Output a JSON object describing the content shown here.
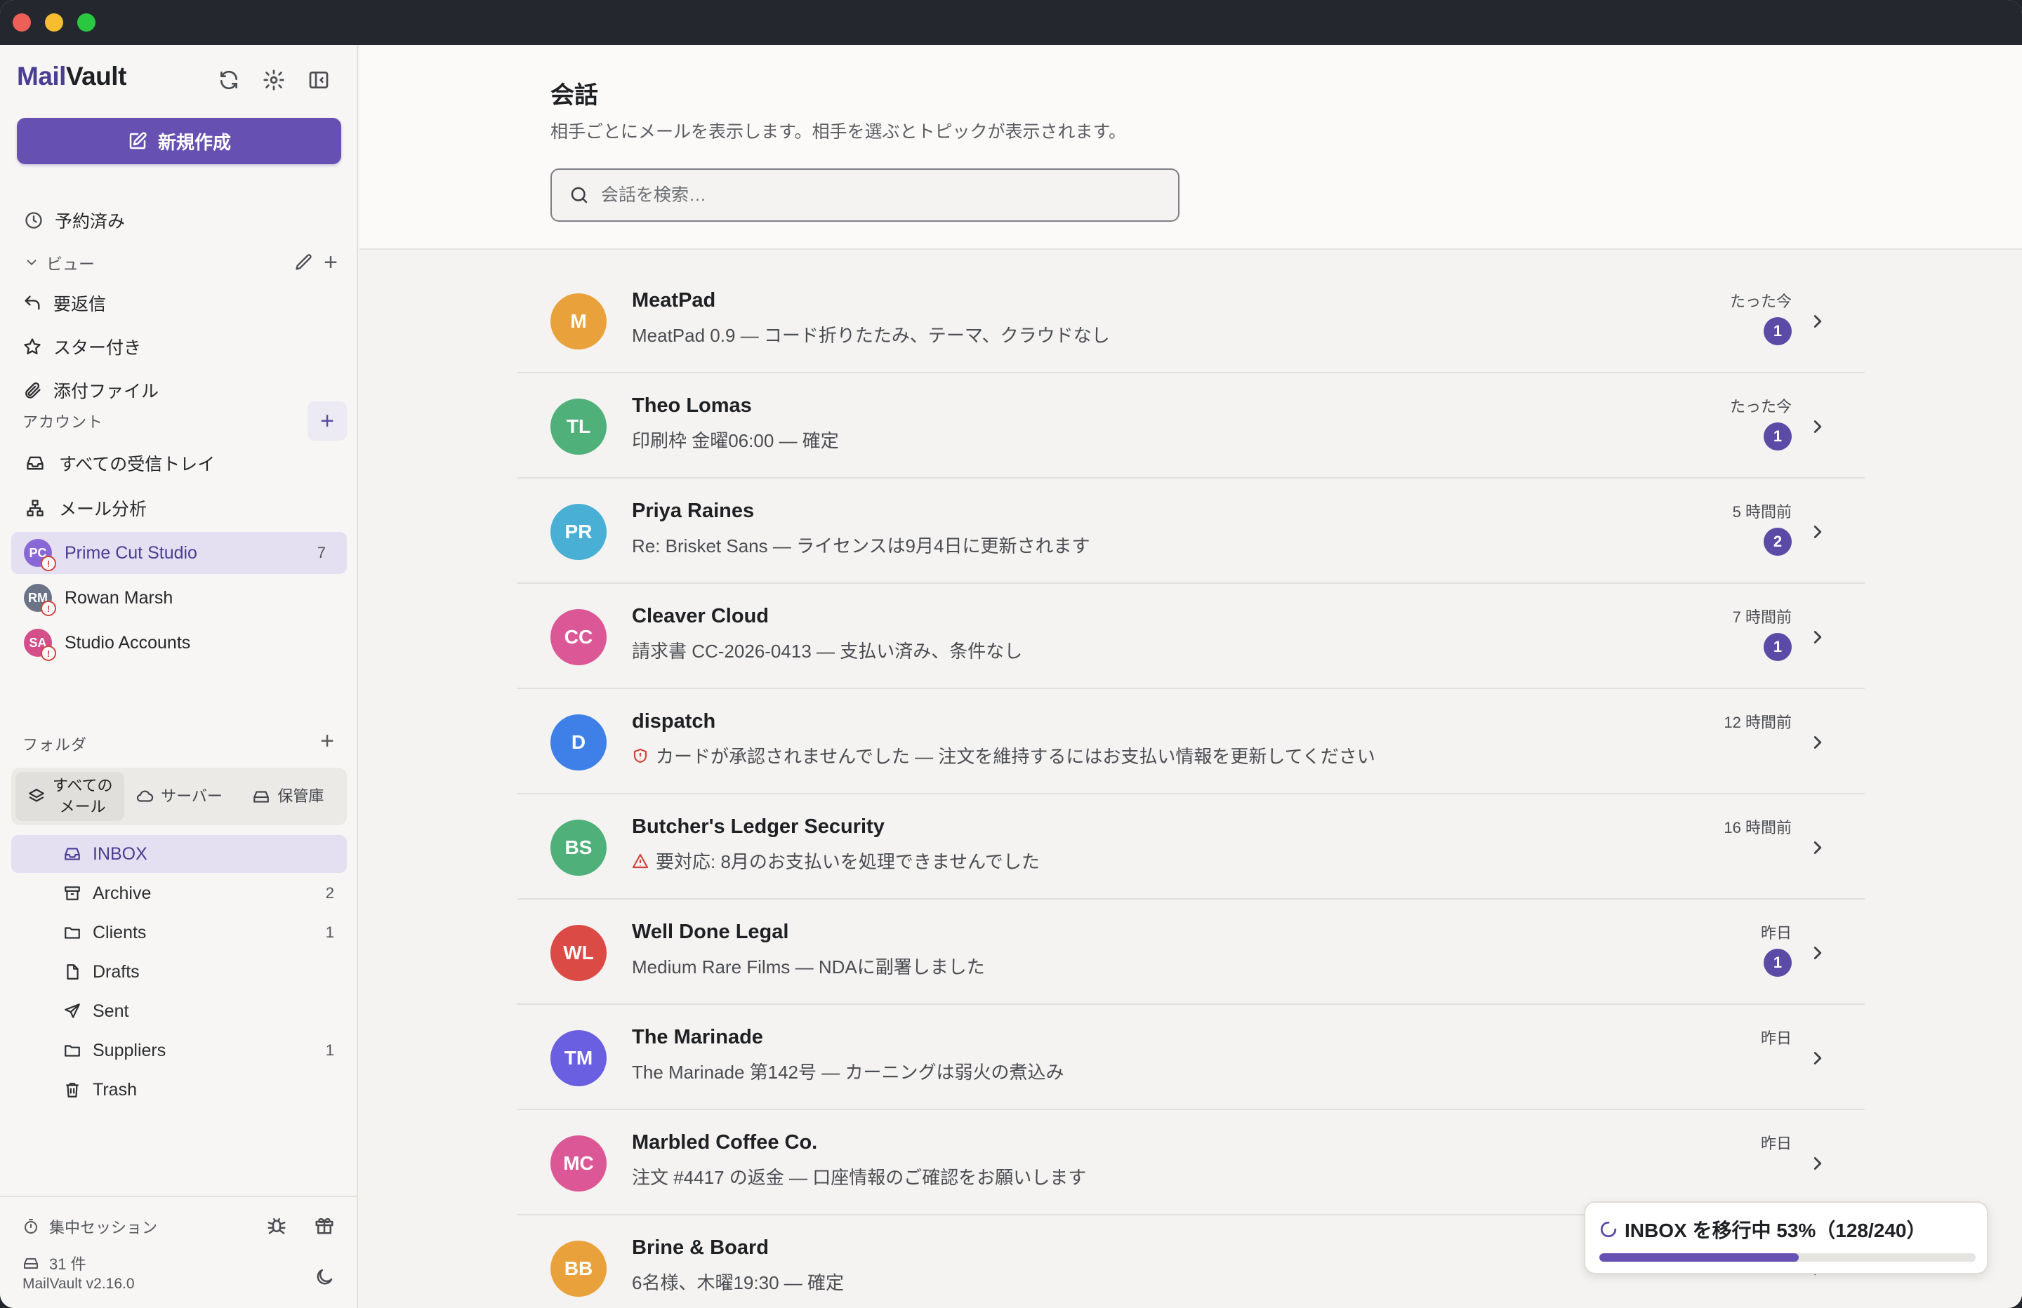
{
  "app": {
    "brand_part1": "Mail",
    "brand_part2": "Vault"
  },
  "sidebar": {
    "compose_label": "新規作成",
    "scheduled_label": "予約済み",
    "views_label": "ビュー",
    "views": [
      {
        "label": "要返信",
        "icon": "reply-icon"
      },
      {
        "label": "スター付き",
        "icon": "star-icon"
      },
      {
        "label": "添付ファイル",
        "icon": "paperclip-icon"
      }
    ],
    "accounts_label": "アカウント",
    "all_inbox_label": "すべての受信トレイ",
    "analytics_label": "メール分析",
    "accounts": [
      {
        "label": "Prime Cut Studio",
        "initials": "PC",
        "count": "7",
        "color": "#8a67d6"
      },
      {
        "label": "Rowan Marsh",
        "initials": "RM",
        "count": "",
        "color": "#6b7487"
      },
      {
        "label": "Studio Accounts",
        "initials": "SA",
        "count": "",
        "color": "#d44f8a"
      }
    ],
    "folders_label": "フォルダ",
    "segments": {
      "all": "すべての\nメール",
      "server": "サーバー",
      "vault": "保管庫"
    },
    "folders": [
      {
        "label": "INBOX",
        "count": ""
      },
      {
        "label": "Archive",
        "count": "2"
      },
      {
        "label": "Clients",
        "count": "1"
      },
      {
        "label": "Drafts",
        "count": ""
      },
      {
        "label": "Sent",
        "count": ""
      },
      {
        "label": "Suppliers",
        "count": "1"
      },
      {
        "label": "Trash",
        "count": ""
      }
    ],
    "footer": {
      "focus_label": "集中セッション",
      "storage_label": "31 件",
      "version": "MailVault v2.16.0"
    }
  },
  "main": {
    "title": "会話",
    "subtitle": "相手ごとにメールを表示します。相手を選ぶとトピックが表示されます。",
    "search_placeholder": "会話を検索…",
    "conversations": [
      {
        "initials": "M",
        "color": "#e9a23b",
        "name": "MeatPad",
        "subject": "MeatPad 0.9 — コード折りたたみ、テーマ、クラウドなし",
        "time": "たった今",
        "badge": "1",
        "alert": ""
      },
      {
        "initials": "TL",
        "color": "#4fb07a",
        "name": "Theo Lomas",
        "subject": "印刷枠 金曜06:00 — 確定",
        "time": "たった今",
        "badge": "1",
        "alert": ""
      },
      {
        "initials": "PR",
        "color": "#4aafd4",
        "name": "Priya Raines",
        "subject": "Re: Brisket Sans — ライセンスは9月4日に更新されます",
        "time": "5 時間前",
        "badge": "2",
        "alert": ""
      },
      {
        "initials": "CC",
        "color": "#dc5796",
        "name": "Cleaver Cloud",
        "subject": "請求書 CC-2026-0413 — 支払い済み、条件なし",
        "time": "7 時間前",
        "badge": "1",
        "alert": ""
      },
      {
        "initials": "D",
        "color": "#3f80e8",
        "name": "dispatch",
        "subject": "カードが承認されませんでした — 注文を維持するにはお支払い情報を更新してください",
        "time": "12 時間前",
        "badge": "",
        "alert": "shield"
      },
      {
        "initials": "BS",
        "color": "#4fb07a",
        "name": "Butcher's Ledger Security",
        "subject": "要対応: 8月のお支払いを処理できませんでした",
        "time": "16 時間前",
        "badge": "",
        "alert": "warning"
      },
      {
        "initials": "WL",
        "color": "#dc4a45",
        "name": "Well Done Legal",
        "subject": "Medium Rare Films — NDAに副署しました",
        "time": "昨日",
        "badge": "1",
        "alert": ""
      },
      {
        "initials": "TM",
        "color": "#6a5fe0",
        "name": "The Marinade",
        "subject": "The Marinade 第142号 — カーニングは弱火の煮込み",
        "time": "昨日",
        "badge": "",
        "alert": ""
      },
      {
        "initials": "MC",
        "color": "#dc5796",
        "name": "Marbled Coffee Co.",
        "subject": "注文 #4417 の返金 — 口座情報のご確認をお願いします",
        "time": "昨日",
        "badge": "",
        "alert": ""
      },
      {
        "initials": "BB",
        "color": "#e9a23b",
        "name": "Brine & Board",
        "subject": "6名様、木曜19:30 — 確定",
        "time": "",
        "badge": "",
        "alert": ""
      }
    ]
  },
  "migration": {
    "label": "INBOX を移行中 53%（128/240）",
    "progress": 0.53
  }
}
